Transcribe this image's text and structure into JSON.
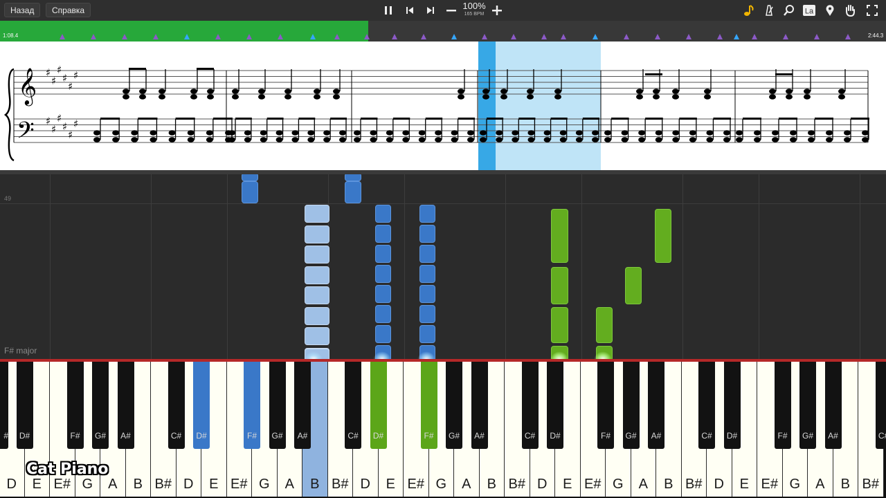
{
  "toolbar": {
    "back_label": "Назад",
    "help_label": "Справка",
    "tempo_percent": "100%",
    "tempo_bpm": "165 BPM",
    "icons": [
      "pause-icon",
      "skip-back-icon",
      "skip-forward-icon",
      "minus-icon",
      "plus-icon",
      "note-icon",
      "metronome-icon",
      "search-icon",
      "label-icon",
      "location-pin-icon",
      "hand-icon",
      "fullscreen-icon"
    ],
    "label_icon_text": "La"
  },
  "progress": {
    "elapsed": "1:08.4",
    "total": "2:44.3",
    "played_fraction": 0.416
  },
  "roll": {
    "measure_number": "49",
    "key_label": "F# major"
  },
  "keyboard": {
    "white_labels": [
      "D",
      "E",
      "E#",
      "G",
      "A",
      "B",
      "B#",
      "D",
      "E",
      "E#",
      "G",
      "A",
      "B",
      "B#",
      "D",
      "E",
      "E#",
      "G",
      "A",
      "B",
      "B#",
      "D",
      "E",
      "E#",
      "G",
      "A",
      "B",
      "B#",
      "D",
      "E",
      "E#",
      "G",
      "A",
      "B",
      "B#"
    ],
    "black_labels": [
      "D#",
      "F#",
      "G#",
      "A#",
      "C#",
      "D#",
      "F#",
      "G#",
      "A#",
      "C#",
      "D#",
      "F#",
      "G#",
      "A#",
      "C#",
      "D#",
      "F#",
      "G#",
      "A#",
      "C#",
      "D#",
      "F#",
      "G#",
      "A#",
      "C#"
    ],
    "first_black_label": "#"
  },
  "logo_text": "Cat Piano",
  "colors": {
    "accent_green": "#27a83a",
    "note_blue": "#3a78c8",
    "note_light_blue": "#9fc0e6",
    "note_green": "#63ad1f",
    "highlight": "#bfe4f7",
    "cursor": "#37a8e6"
  }
}
